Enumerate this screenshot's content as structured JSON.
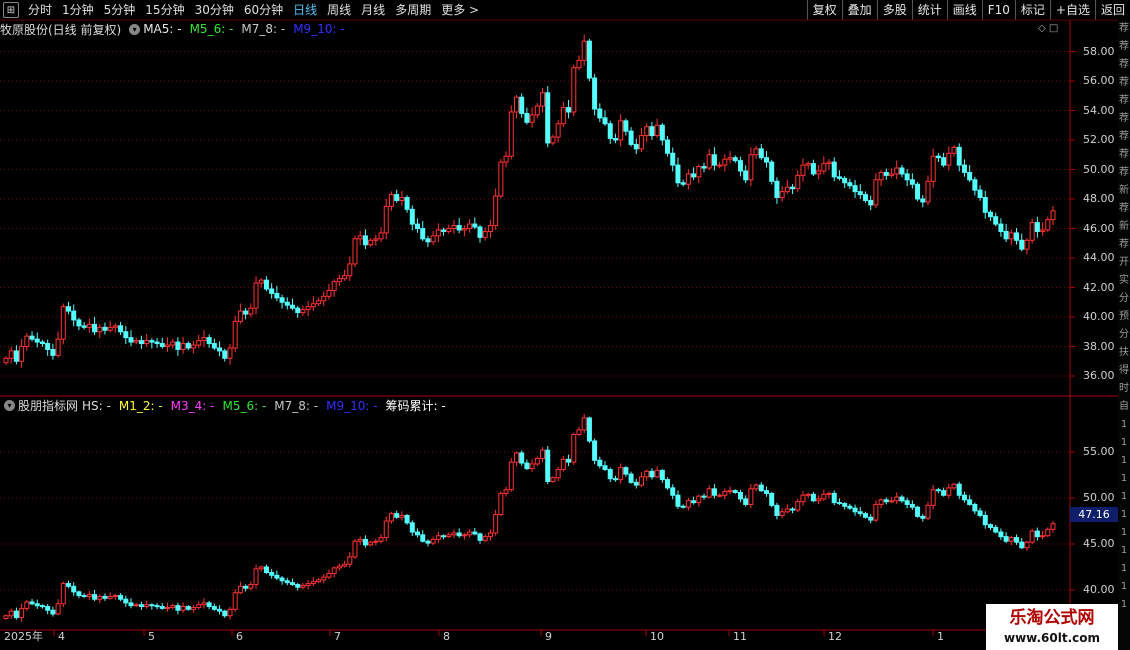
{
  "toolbar": {
    "timeframes": [
      "分时",
      "1分钟",
      "5分钟",
      "15分钟",
      "30分钟",
      "60分钟",
      "日线",
      "周线",
      "月线",
      "多周期",
      "更多 >"
    ],
    "active_timeframe": "日线",
    "right_buttons": [
      "复权",
      "叠加",
      "多股",
      "统计",
      "画线",
      "F10",
      "标记",
      "+自选",
      "返回"
    ]
  },
  "panel1": {
    "title": "牧原股份(日线 前复权)",
    "indicators": [
      {
        "label": "MA5: -",
        "color": "#e6e6e6"
      },
      {
        "label": "M5_6: -",
        "color": "#32e632"
      },
      {
        "label": "M7_8: -",
        "color": "#c8c8c8"
      },
      {
        "label": "M9_10: -",
        "color": "#3030ff"
      }
    ],
    "y_ticks": [
      "58.00",
      "56.00",
      "54.00",
      "52.00",
      "50.00",
      "48.00",
      "46.00",
      "44.00",
      "42.00",
      "40.00",
      "38.00",
      "36.00"
    ]
  },
  "panel2": {
    "title": "股朋指标网",
    "indicators": [
      {
        "label": "HS: -",
        "color": "#dcdcdc"
      },
      {
        "label": "M1_2: -",
        "color": "#ffff3c"
      },
      {
        "label": "M3_4: -",
        "color": "#ff3cff"
      },
      {
        "label": "M5_6: -",
        "color": "#32e632"
      },
      {
        "label": "M7_8: -",
        "color": "#c8c8c8"
      },
      {
        "label": "M9_10: -",
        "color": "#3030ff"
      },
      {
        "label": "筹码累计: -",
        "color": "#ffffff"
      }
    ],
    "y_ticks": [
      "55.00",
      "50.00",
      "45.00",
      "40.00"
    ],
    "current_price": "47.16"
  },
  "x_axis": [
    "2025年",
    "4",
    "5",
    "6",
    "7",
    "8",
    "9",
    "10",
    "11",
    "12",
    "1"
  ],
  "side_strip": [
    "荐",
    "荐",
    "荐",
    "荐",
    "荐",
    "荐",
    "荐",
    "荐",
    "荐",
    "新",
    "荐",
    "新",
    "荐",
    "开",
    "实",
    "分",
    "预",
    "分",
    "扶",
    "得",
    "时",
    "自",
    "1",
    "1",
    "1",
    "1",
    "1",
    "1",
    "1",
    "1",
    "1",
    "1",
    "1"
  ],
  "watermark": {
    "line1": "乐淘公式网",
    "line2": "www.60lt.com"
  },
  "colors": {
    "up": "#ff3232",
    "down": "#54ffff",
    "grid": "#7a0000",
    "frame": "#aa0000"
  },
  "chart_data": {
    "type": "candlestick",
    "series": [
      {
        "name": "牧原股份",
        "values": [
          37.2,
          37.7,
          37.0,
          38.0,
          38.7,
          38.5,
          38.3,
          38.2,
          37.8,
          37.4,
          38.5,
          40.7,
          40.4,
          39.8,
          39.4,
          39.3,
          39.5,
          39.0,
          39.3,
          39.1,
          39.3,
          39.4,
          39.0,
          38.6,
          38.3,
          38.4,
          38.2,
          38.4,
          38.3,
          38.2,
          38.0,
          38.1,
          38.3,
          37.8,
          38.2,
          37.9,
          38.1,
          38.4,
          38.6,
          38.2,
          37.9,
          37.7,
          37.2,
          37.9,
          39.7,
          40.4,
          40.2,
          40.6,
          42.3,
          42.5,
          41.9,
          41.6,
          41.3,
          41.0,
          40.8,
          40.6,
          40.3,
          40.5,
          40.7,
          40.9,
          41.1,
          41.4,
          41.8,
          42.4,
          42.6,
          42.8,
          43.6,
          45.3,
          45.5,
          44.9,
          45.2,
          45.3,
          45.7,
          47.5,
          48.3,
          47.9,
          48.1,
          47.3,
          46.3,
          46.0,
          45.3,
          45.1,
          45.5,
          45.9,
          45.8,
          46.0,
          46.2,
          45.9,
          46.0,
          46.3,
          46.1,
          45.4,
          45.8,
          46.2,
          48.2,
          50.5,
          50.9,
          53.9,
          54.9,
          53.8,
          53.2,
          53.7,
          54.3,
          55.2,
          51.8,
          52.2,
          53.1,
          54.2,
          53.9,
          56.9,
          57.4,
          58.7,
          56.2,
          54.1,
          53.5,
          53.1,
          52.1,
          52.0,
          53.3,
          52.6,
          51.7,
          51.4,
          52.3,
          52.9,
          52.3,
          53.0,
          52.0,
          51.1,
          50.3,
          49.1,
          49.0,
          49.7,
          49.5,
          50.2,
          50.1,
          51.0,
          50.3,
          50.3,
          50.7,
          50.8,
          50.6,
          49.9,
          49.3,
          51.0,
          51.4,
          50.8,
          50.5,
          49.2,
          48.1,
          48.5,
          48.8,
          48.7,
          49.6,
          50.3,
          50.4,
          49.7,
          49.9,
          50.4,
          50.5,
          49.5,
          49.4,
          49.1,
          48.9,
          48.5,
          48.3,
          47.9,
          47.6,
          49.3,
          49.8,
          49.6,
          49.7,
          50.1,
          49.7,
          49.3,
          49.0,
          48.0,
          47.8,
          49.2,
          50.9,
          50.8,
          50.3,
          51.1,
          51.5,
          50.3,
          49.8,
          49.3,
          48.6,
          48.1,
          47.1,
          46.8,
          46.3,
          45.8,
          45.3,
          45.7,
          45.2,
          44.6,
          45.2,
          46.4,
          45.8,
          45.9,
          46.6,
          47.2
        ]
      }
    ]
  }
}
